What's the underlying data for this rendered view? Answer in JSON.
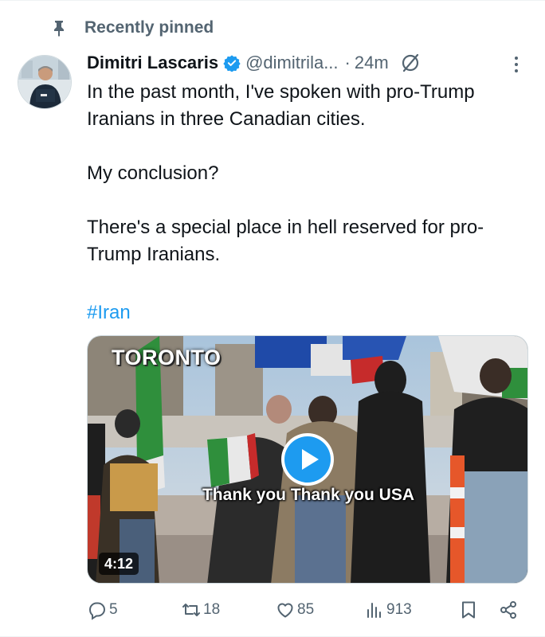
{
  "pinned": {
    "label": "Recently pinned"
  },
  "author": {
    "display_name": "Dimitri Lascaris",
    "handle": "@dimitrila...",
    "separator": "·",
    "time": "24m"
  },
  "tweet": {
    "paragraphs": [
      "In the past month, I've spoken with pro-Trump Iranians in three Canadian cities.",
      "My conclusion?",
      "There's a special place in hell reserved for pro-Trump Iranians."
    ],
    "hashtag": "#Iran"
  },
  "media": {
    "overlay_title": "TORONTO",
    "caption": "Thank you Thank you USA",
    "duration": "4:12"
  },
  "actions": {
    "replies": "5",
    "reposts": "18",
    "likes": "85",
    "views": "913"
  },
  "colors": {
    "accent": "#1d9bf0",
    "secondary_text": "#536471",
    "primary_text": "#0f1419"
  },
  "icons": [
    "pin-icon",
    "verified-icon",
    "grok-icon",
    "more-icon",
    "play-icon",
    "reply-icon",
    "repost-icon",
    "like-icon",
    "views-icon",
    "bookmark-icon",
    "share-icon"
  ]
}
